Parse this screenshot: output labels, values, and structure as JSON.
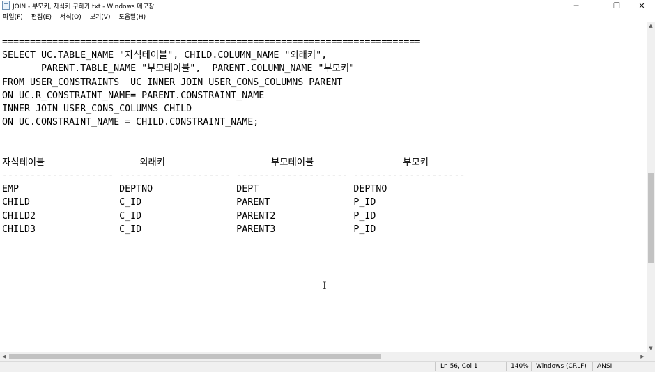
{
  "window": {
    "title": "JOIN - 부모키, 자식키 구하기.txt - Windows 메모장",
    "minimize_glyph": "─",
    "maximize_glyph": "❐",
    "close_glyph": "✕"
  },
  "menu": {
    "items": [
      "파일(F)",
      "편집(E)",
      "서식(O)",
      "보기(V)",
      "도움말(H)"
    ]
  },
  "editor": {
    "lines": [
      "===========================================================================",
      "SELECT UC.TABLE_NAME \"자식테이블\", CHILD.COLUMN_NAME \"외래키\",",
      "       PARENT.TABLE_NAME \"부모테이블\",  PARENT.COLUMN_NAME \"부모키\"",
      "FROM USER_CONSTRAINTS  UC INNER JOIN USER_CONS_COLUMNS PARENT",
      "ON UC.R_CONSTRAINT_NAME= PARENT.CONSTRAINT_NAME",
      "INNER JOIN USER_CONS_COLUMNS CHILD",
      "ON UC.CONSTRAINT_NAME = CHILD.CONSTRAINT_NAME;",
      "",
      "",
      "자식테이블                 외래키                   부모테이블                부모키",
      "-------------------- -------------------- -------------------- --------------------",
      "EMP                  DEPTNO               DEPT                 DEPTNO",
      "CHILD                C_ID                 PARENT               P_ID",
      "CHILD2               C_ID                 PARENT2              P_ID",
      "CHILD3               C_ID                 PARENT3              P_ID"
    ],
    "text": ""
  },
  "scrollbars": {
    "up_glyph": "▲",
    "down_glyph": "▼",
    "left_glyph": "◀",
    "right_glyph": "▶"
  },
  "status": {
    "position": "Ln 56, Col 1",
    "zoom": "140%",
    "line_ending": "Windows (CRLF)",
    "encoding": "ANSI"
  }
}
